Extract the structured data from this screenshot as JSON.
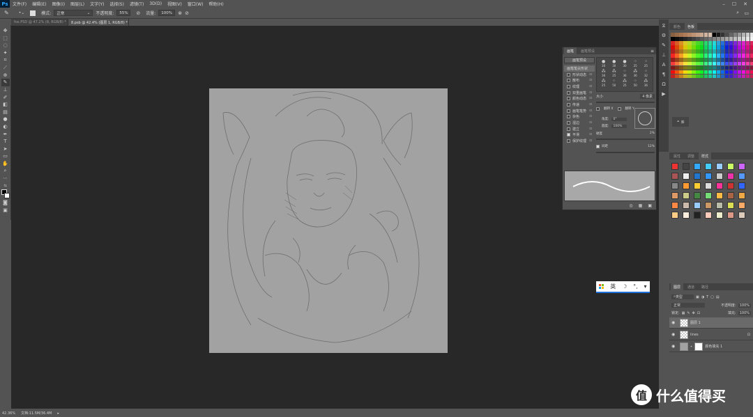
{
  "app": {
    "logo": "Ps"
  },
  "menu": [
    "文件(F)",
    "编辑(E)",
    "图像(I)",
    "图层(L)",
    "文字(Y)",
    "选择(S)",
    "滤镜(T)",
    "3D(D)",
    "视图(V)",
    "窗口(W)",
    "帮助(H)"
  ],
  "options": {
    "mode_label": "模式:",
    "mode_value": "正常",
    "opacity_label": "不透明度:",
    "opacity_value": "55%",
    "flow_label": "流量:",
    "flow_value": "100%"
  },
  "tabs": [
    {
      "label": "fox.PSD @ 47.2% (8, RGB/8) *"
    },
    {
      "label": "8.psb @ 42.4% (图层 1, RGB/8) *"
    }
  ],
  "status": {
    "zoom": "42.36%",
    "doc": "文档:11.5M/36.4M"
  },
  "brush_panel": {
    "tab_brush": "画笔",
    "tab_presets": "画笔预设",
    "preset_button": "画笔预设",
    "tip_shape": "画笔笔尖形状",
    "options": [
      {
        "label": "形状动态",
        "checked": false
      },
      {
        "label": "散布",
        "checked": false
      },
      {
        "label": "纹理",
        "checked": false
      },
      {
        "label": "双重画笔",
        "checked": false
      },
      {
        "label": "颜色动态",
        "checked": false
      },
      {
        "label": "传递",
        "checked": false
      },
      {
        "label": "画笔笔势",
        "checked": false
      },
      {
        "label": "杂色",
        "checked": false
      },
      {
        "label": "湿边",
        "checked": false
      },
      {
        "label": "建立",
        "checked": false
      },
      {
        "label": "平滑",
        "checked": true
      },
      {
        "label": "保护纹理",
        "checked": false
      }
    ],
    "size_label": "大小",
    "size_value": "4 像素",
    "flipx": "翻转 X",
    "flipy": "翻转 Y",
    "angle_label": "角度:",
    "angle_value": "0°",
    "roundness_label": "圆度:",
    "roundness_value": "100%",
    "hardness_label": "硬度",
    "hardness_value": "2%",
    "spacing_label": "间距",
    "spacing_value": "12%",
    "tip_sizes": [
      "30",
      "30",
      "30",
      "25",
      "25",
      "36",
      "25",
      "36",
      "36",
      "32",
      "25",
      "50",
      "25",
      "50",
      "36"
    ]
  },
  "color_panel": {
    "tab_color": "颜色",
    "tab_swatches": "色板"
  },
  "library": {
    "label": "库"
  },
  "styles_panel": {
    "tab_props": "属性",
    "tab_adjust": "调整",
    "tab_styles": "样式"
  },
  "ime": {
    "lang": "英"
  },
  "layers_panel": {
    "tab_layers": "图层",
    "tab_channels": "通道",
    "tab_paths": "路径",
    "filter_label": "类型",
    "blend_value": "正常",
    "opacity_label": "不透明度:",
    "opacity_value": "100%",
    "lock_label": "锁定:",
    "fill_label": "填充:",
    "fill_value": "100%",
    "layers": [
      {
        "name": "图层 1",
        "selected": true
      },
      {
        "name": "lines",
        "selected": false
      },
      {
        "name": "颜色填充 1",
        "selected": false
      }
    ]
  },
  "watermark": {
    "text": "什么值得买",
    "badge": "值"
  },
  "colors": {
    "workspace": "#282828",
    "canvas": "#a2a2a2",
    "panel": "#535353",
    "ime_accent": "#1e6fd9"
  }
}
